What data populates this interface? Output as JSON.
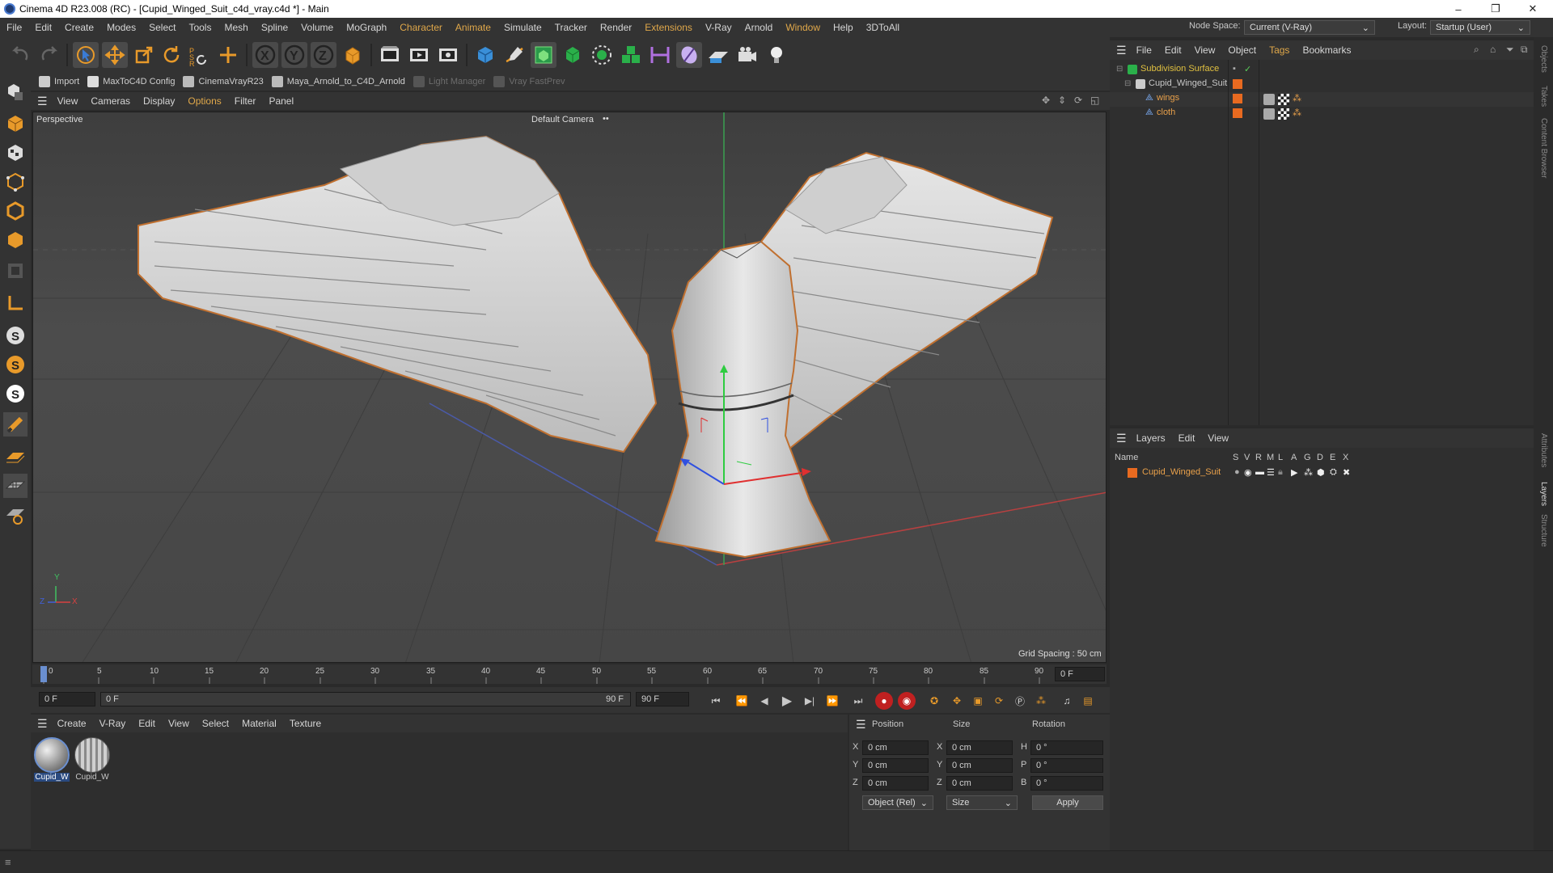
{
  "window": {
    "title": "Cinema 4D R23.008 (RC) - [Cupid_Winged_Suit_c4d_vray.c4d *] - Main",
    "minimize": "–",
    "maximize": "❐",
    "close": "✕"
  },
  "menubar": {
    "items": [
      "File",
      "Edit",
      "Create",
      "Modes",
      "Select",
      "Tools",
      "Mesh",
      "Spline",
      "Volume",
      "MoGraph",
      "Character",
      "Animate",
      "Simulate",
      "Tracker",
      "Render",
      "Extensions",
      "V-Ray",
      "Arnold",
      "Window",
      "Help",
      "3DToAll"
    ],
    "node_space_label": "Node Space:",
    "node_space_value": "Current (V-Ray)",
    "layout_label": "Layout:",
    "layout_value": "Startup (User)"
  },
  "plugins": [
    "Import",
    "MaxToC4D Config",
    "CinemaVrayR23",
    "Maya_Arnold_to_C4D_Arnold",
    "Light Manager",
    "Vray FastPrev"
  ],
  "viewport": {
    "menu": [
      "View",
      "Cameras",
      "Display",
      "Options",
      "Filter",
      "Panel"
    ],
    "projection": "Perspective",
    "camera": "Default Camera",
    "camera_icon": "••",
    "grid_spacing": "Grid Spacing : 50 cm",
    "axis_x": "X",
    "axis_y": "Y",
    "axis_z": "Z"
  },
  "timeline": {
    "ticks": [
      "0",
      "5",
      "10",
      "15",
      "20",
      "25",
      "30",
      "35",
      "40",
      "45",
      "50",
      "55",
      "60",
      "65",
      "70",
      "75",
      "80",
      "85",
      "90"
    ],
    "current_frame": "0 F",
    "start_frame": "0 F",
    "range_start": "0 F",
    "range_end": "90 F",
    "end_frame": "90 F"
  },
  "materials": {
    "menu": [
      "Create",
      "V-Ray",
      "Edit",
      "View",
      "Select",
      "Material",
      "Texture"
    ],
    "items": [
      "Cupid_W",
      "Cupid_W"
    ]
  },
  "coords": {
    "headers": [
      "Position",
      "Size",
      "Rotation"
    ],
    "rows": [
      {
        "axis": "X",
        "pos": "0 cm",
        "size_axis": "X",
        "size": "0 cm",
        "rot_axis": "H",
        "rot": "0 °"
      },
      {
        "axis": "Y",
        "pos": "0 cm",
        "size_axis": "Y",
        "size": "0 cm",
        "rot_axis": "P",
        "rot": "0 °"
      },
      {
        "axis": "Z",
        "pos": "0 cm",
        "size_axis": "Z",
        "size": "0 cm",
        "rot_axis": "B",
        "rot": "0 °"
      }
    ],
    "mode": "Object (Rel)",
    "size_mode": "Size",
    "apply": "Apply"
  },
  "objects": {
    "menu": [
      "File",
      "Edit",
      "View",
      "Object",
      "Tags",
      "Bookmarks"
    ],
    "items": [
      {
        "name": "Subdivision Surface",
        "indent": 0
      },
      {
        "name": "Cupid_Winged_Suit",
        "indent": 1
      },
      {
        "name": "wings",
        "indent": 2
      },
      {
        "name": "cloth",
        "indent": 2
      }
    ]
  },
  "layers": {
    "menu": [
      "Layers",
      "Edit",
      "View"
    ],
    "col_name": "Name",
    "cols": [
      "S",
      "V",
      "R",
      "M",
      "L",
      "A",
      "G",
      "D",
      "E",
      "X"
    ],
    "items": [
      "Cupid_Winged_Suit"
    ]
  },
  "side_tabs": [
    "Objects",
    "Takes",
    "Content Browser",
    "Attributes",
    "Layers",
    "Structure"
  ],
  "colors": {
    "accent": "#e8a04a",
    "bg": "#333333",
    "viewport": "#474747",
    "x_axis": "#d84040",
    "y_axis": "#40c060",
    "z_axis": "#4060d8"
  }
}
